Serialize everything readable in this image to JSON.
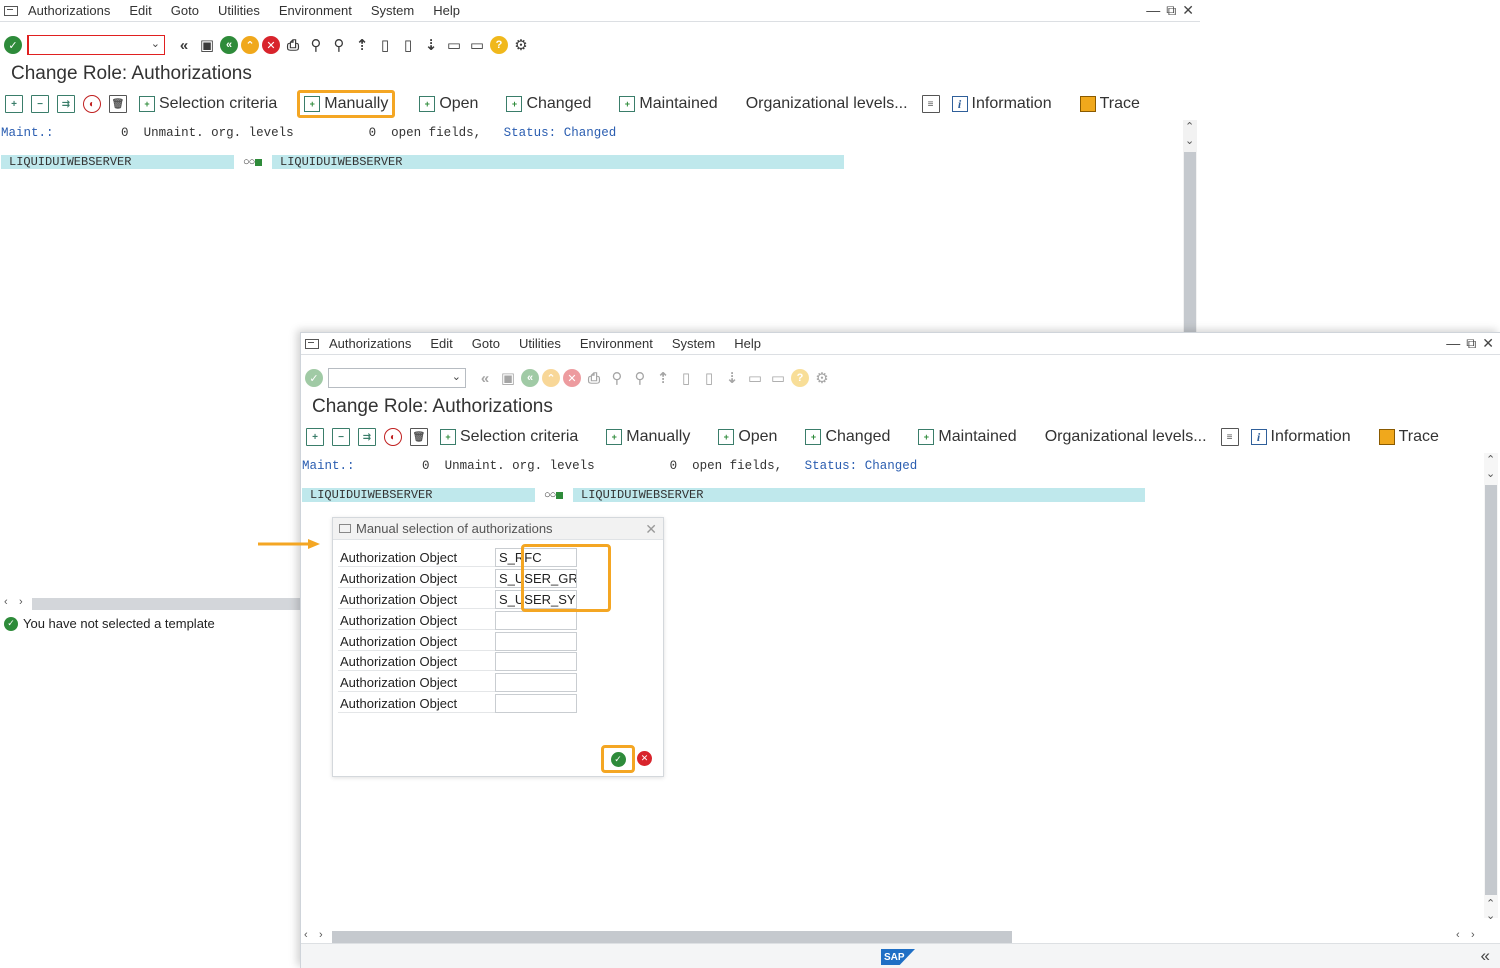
{
  "menu": {
    "items": [
      "Authorizations",
      "Edit",
      "Goto",
      "Utilities",
      "Environment",
      "System",
      "Help"
    ]
  },
  "window_controls": {
    "minimize": "—",
    "restore": "⧉",
    "close": "✕"
  },
  "page_title": "Change Role: Authorizations",
  "app_toolbar": {
    "selection_criteria": "Selection criteria",
    "manually": "Manually",
    "open": "Open",
    "changed": "Changed",
    "maintained": "Maintained",
    "org_levels": "Organizational levels...",
    "information": "Information",
    "trace": "Trace"
  },
  "status_line": {
    "maint_label": "Maint.:",
    "maint_count": "0",
    "unmaint_label": "Unmaint. org. levels",
    "open_count": "0",
    "open_label": "open fields,",
    "status_label": "Status:",
    "status_value": "Changed"
  },
  "tree": {
    "left_node": "LIQUIDUIWEBSERVER",
    "right_node": "LIQUIDUIWEBSERVER"
  },
  "status_message": "You have not selected a template",
  "dialog": {
    "title": "Manual selection of authorizations",
    "label": "Authorization Object",
    "rows": [
      {
        "label": "Authorization Object",
        "value": "S_RFC"
      },
      {
        "label": "Authorization Object",
        "value": "S_USER_GRP"
      },
      {
        "label": "Authorization Object",
        "value": "S_USER_SYS"
      },
      {
        "label": "Authorization Object",
        "value": ""
      },
      {
        "label": "Authorization Object",
        "value": ""
      },
      {
        "label": "Authorization Object",
        "value": ""
      },
      {
        "label": "Authorization Object",
        "value": ""
      },
      {
        "label": "Authorization Object",
        "value": ""
      }
    ]
  },
  "sap_logo": "SAP",
  "colors": {
    "highlight": "#f4a623",
    "tree_bar": "#bfe8ec",
    "status_blue": "#2a5db0",
    "ok_green": "#2e8b3a",
    "cancel_red": "#d8242c"
  }
}
